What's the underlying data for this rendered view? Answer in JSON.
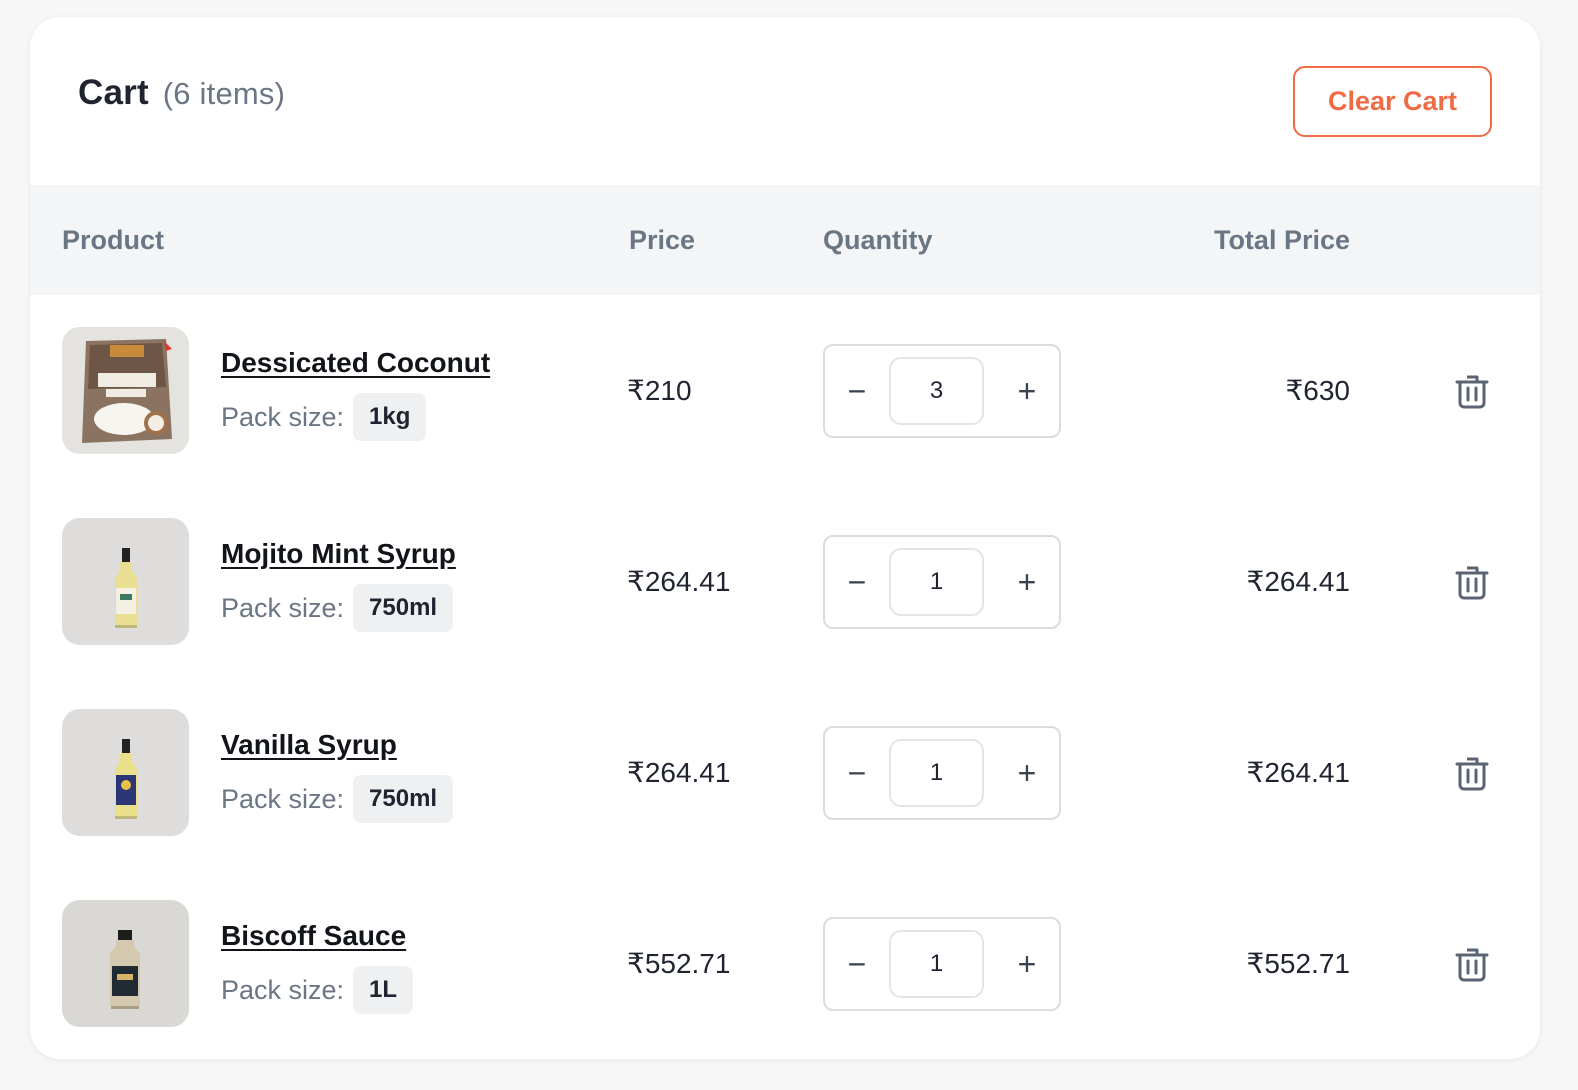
{
  "cart": {
    "title": "Cart",
    "count_text": "(6 items)",
    "clear_label": "Clear Cart"
  },
  "table": {
    "headers": {
      "product": "Product",
      "price": "Price",
      "quantity": "Quantity",
      "total": "Total Price"
    }
  },
  "items": [
    {
      "name": "Dessicated Coconut",
      "pack_label": "Pack size:",
      "pack": "1kg",
      "price": "₹210",
      "qty": "3",
      "total": "₹630",
      "thumb": "coconut-powder-pack"
    },
    {
      "name": "Mojito Mint Syrup",
      "pack_label": "Pack size:",
      "pack": "750ml",
      "price": "₹264.41",
      "qty": "1",
      "total": "₹264.41",
      "thumb": "syrup-bottle"
    },
    {
      "name": "Vanilla Syrup",
      "pack_label": "Pack size:",
      "pack": "750ml",
      "price": "₹264.41",
      "qty": "1",
      "total": "₹264.41",
      "thumb": "syrup-bottle"
    },
    {
      "name": "Biscoff Sauce",
      "pack_label": "Pack size:",
      "pack": "1L",
      "price": "₹552.71",
      "qty": "1",
      "total": "₹552.71",
      "thumb": "sauce-bottle"
    }
  ],
  "controls": {
    "minus_glyph": "−",
    "plus_glyph": "+",
    "delete_icon": "trash-icon"
  },
  "colors": {
    "accent": "#ef6a45",
    "header_bg": "#f4f5f7",
    "muted_text": "#6b7685"
  }
}
